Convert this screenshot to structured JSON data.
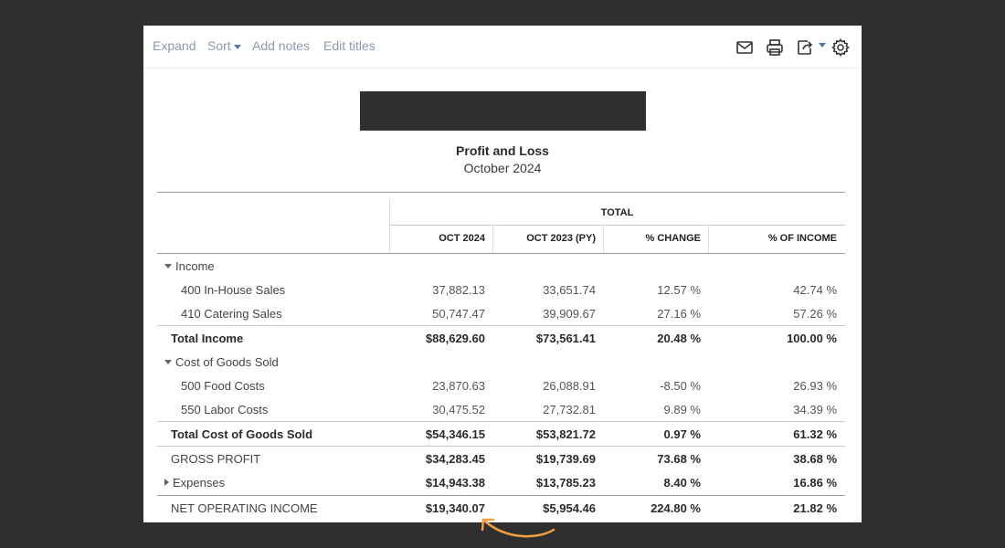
{
  "toolbar": {
    "expand": "Expand",
    "sort": "Sort",
    "add_notes": "Add notes",
    "edit_titles": "Edit titles",
    "icons": [
      "email-icon",
      "print-icon",
      "export-icon",
      "settings-icon"
    ]
  },
  "report": {
    "title": "Profit and Loss",
    "period": "October 2024"
  },
  "table": {
    "group_header": "TOTAL",
    "columns": [
      "OCT 2024",
      "OCT 2023 (PY)",
      "% CHANGE",
      "% OF INCOME"
    ],
    "rows": [
      {
        "label": "Income",
        "values": [
          "",
          "",
          "",
          ""
        ]
      },
      {
        "label": "400 In-House Sales",
        "values": [
          "37,882.13",
          "33,651.74",
          "12.57 %",
          "42.74 %"
        ]
      },
      {
        "label": "410 Catering Sales",
        "values": [
          "50,747.47",
          "39,909.67",
          "27.16 %",
          "57.26 %"
        ]
      },
      {
        "label": "Total Income",
        "values": [
          "$88,629.60",
          "$73,561.41",
          "20.48 %",
          "100.00 %"
        ]
      },
      {
        "label": "Cost of Goods Sold",
        "values": [
          "",
          "",
          "",
          ""
        ]
      },
      {
        "label": "500 Food Costs",
        "values": [
          "23,870.63",
          "26,088.91",
          "-8.50 %",
          "26.93 %"
        ]
      },
      {
        "label": "550 Labor Costs",
        "values": [
          "30,475.52",
          "27,732.81",
          "9.89 %",
          "34.39 %"
        ]
      },
      {
        "label": "Total Cost of Goods Sold",
        "values": [
          "$54,346.15",
          "$53,821.72",
          "0.97 %",
          "61.32 %"
        ]
      },
      {
        "label": "GROSS PROFIT",
        "values": [
          "$34,283.45",
          "$19,739.69",
          "73.68 %",
          "38.68 %"
        ]
      },
      {
        "label": "Expenses",
        "values": [
          "$14,943.38",
          "$13,785.23",
          "8.40 %",
          "16.86 %"
        ]
      },
      {
        "label": "NET OPERATING INCOME",
        "values": [
          "$19,340.07",
          "$5,954.46",
          "224.80 %",
          "21.82 %"
        ]
      }
    ]
  },
  "colors": {
    "background": "#2f2f2f",
    "link": "#8a9bb0",
    "icon": "#4c77a8",
    "annotation_arrow": "#f0a040"
  }
}
